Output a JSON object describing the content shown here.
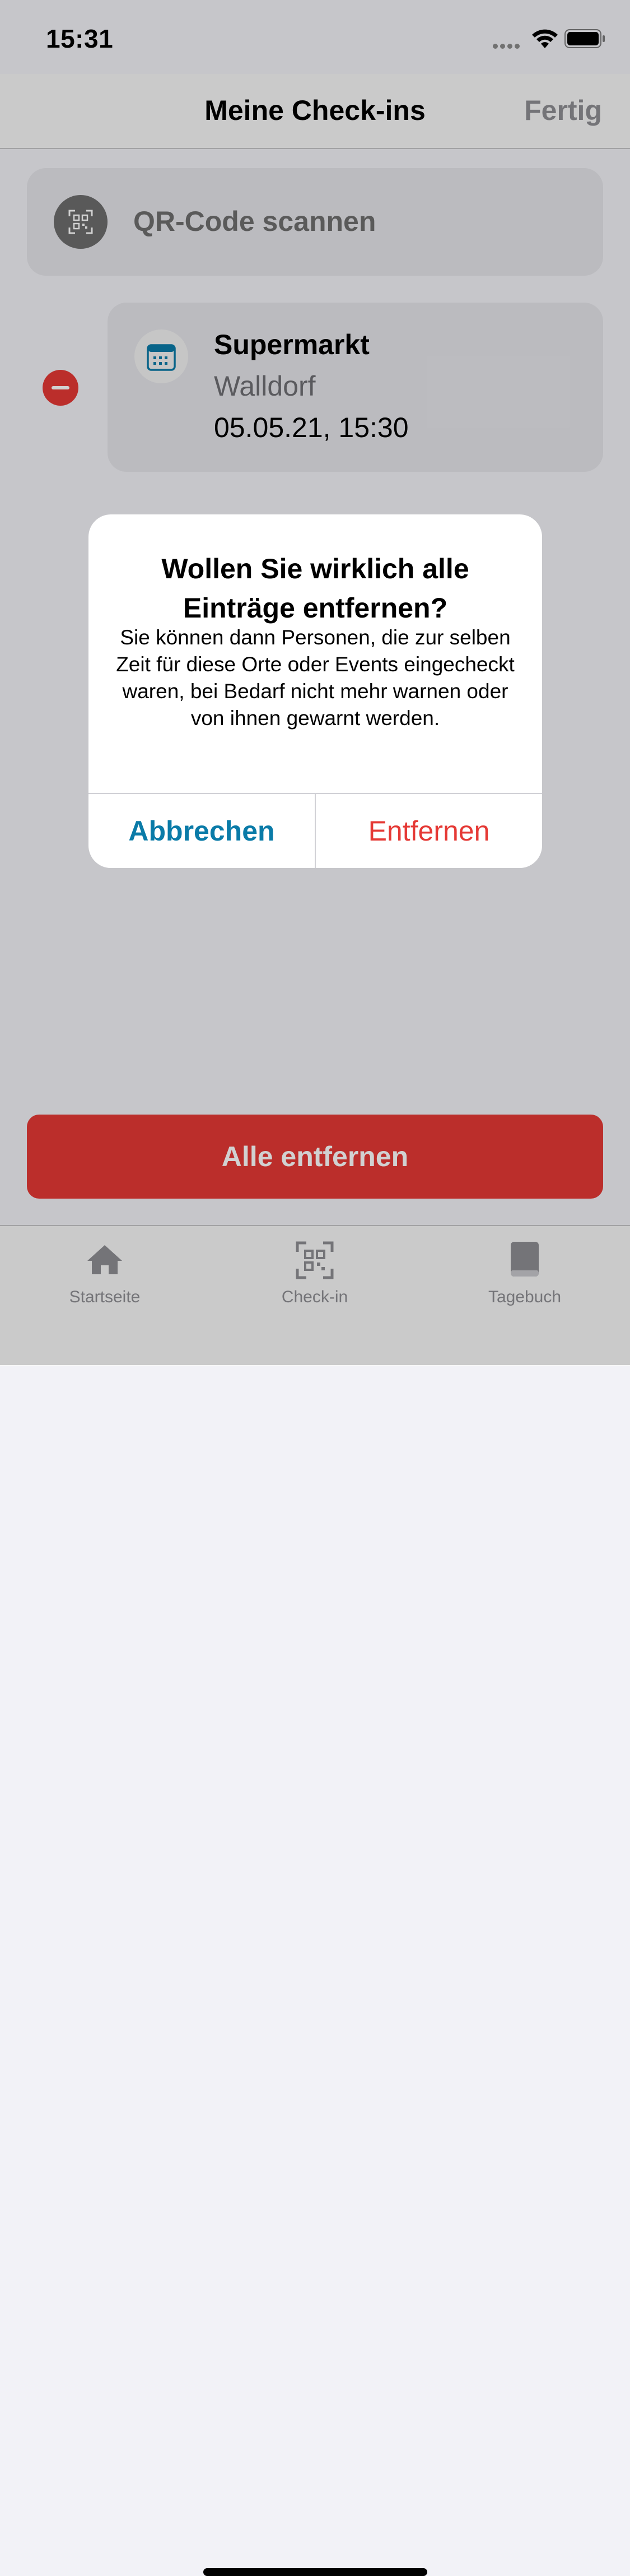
{
  "status_bar": {
    "time": "15:31"
  },
  "nav": {
    "title": "Meine Check-ins",
    "done_label": "Fertig"
  },
  "qr_scan": {
    "label": "QR-Code scannen"
  },
  "checkins": [
    {
      "name": "Supermarkt",
      "place": "Walldorf",
      "datetime": "05.05.21, 15:30"
    }
  ],
  "remove_all_label": "Alle entfernen",
  "alert": {
    "title": "Wollen Sie wirklich alle Einträge entfernen?",
    "message": "Sie können dann Personen, die zur selben Zeit für diese Orte oder Events eingecheckt waren, bei Bedarf nicht mehr warnen oder von ihnen gewarnt werden.",
    "cancel_label": "Abbrechen",
    "confirm_label": "Entfernen"
  },
  "tabs": [
    {
      "label": "Startseite",
      "icon": "house-icon"
    },
    {
      "label": "Check-in",
      "icon": "qr-code-icon"
    },
    {
      "label": "Tagebuch",
      "icon": "book-icon"
    }
  ],
  "colors": {
    "destructive": "#e53935",
    "accent": "#0a7ba8",
    "inactive": "#8e8e93"
  }
}
